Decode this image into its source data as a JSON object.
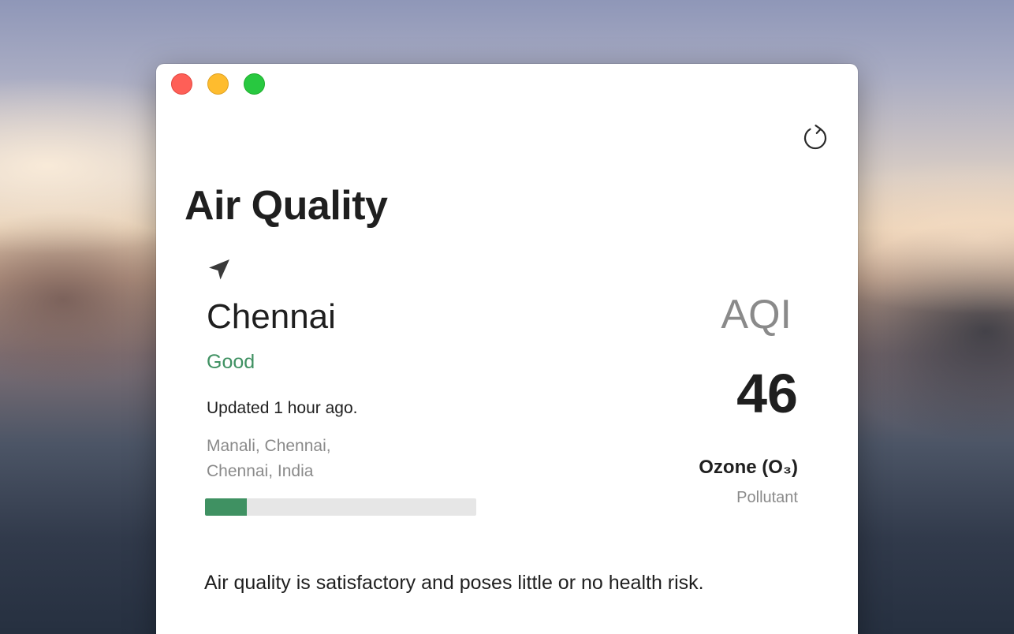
{
  "window": {
    "title": "Air Quality",
    "refresh_icon": "refresh-icon"
  },
  "location": {
    "icon": "location-arrow-icon",
    "city": "Chennai",
    "status": "Good",
    "updated": "Updated 1 hour ago.",
    "station_line1": "Manali, Chennai,",
    "station_line2": "Chennai, India",
    "aqi_fraction": 0.155
  },
  "aqi": {
    "label": "AQI",
    "value": "46",
    "pollutant": "Ozone (O₃)",
    "pollutant_label": "Pollutant"
  },
  "summary": "Air quality is satisfactory and poses little or no health risk.",
  "colors": {
    "good": "#3f9162",
    "bar_track": "#e6e6e6",
    "close": "#fe5f57",
    "minimize": "#febc2e",
    "maximize": "#28c840"
  }
}
